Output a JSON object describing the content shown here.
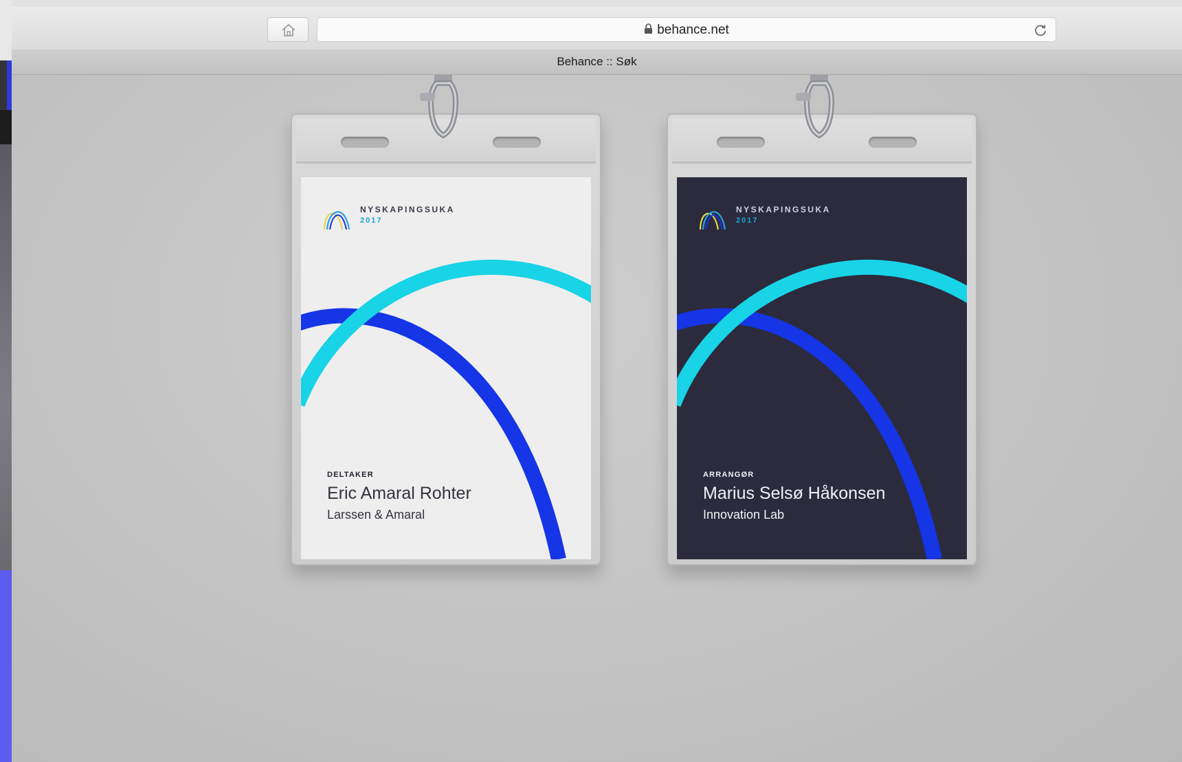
{
  "browser": {
    "url": "behance.net",
    "tab_title": "Behance :: Søk"
  },
  "badges": [
    {
      "brand": "NYSKAPINGSUKA",
      "year": "2017",
      "role": "DELTAKER",
      "name": "Eric Amaral Rohter",
      "organization": "Larssen & Amaral",
      "theme": "light"
    },
    {
      "brand": "NYSKAPINGSUKA",
      "year": "2017",
      "role": "ARRANGØR",
      "name": "Marius Selsø Håkonsen",
      "organization": "Innovation Lab",
      "theme": "dark"
    }
  ],
  "colors": {
    "arc_cyan": "#19d3e6",
    "arc_blue": "#1535e6",
    "card_dark": "#2b2b3d",
    "card_light": "#eeeeee",
    "accent_violet": "#5b5cf0"
  },
  "icons": [
    "home-icon",
    "lock-icon",
    "reload-icon",
    "lanyard-clip-icon",
    "nyskapingsuka-logo"
  ]
}
